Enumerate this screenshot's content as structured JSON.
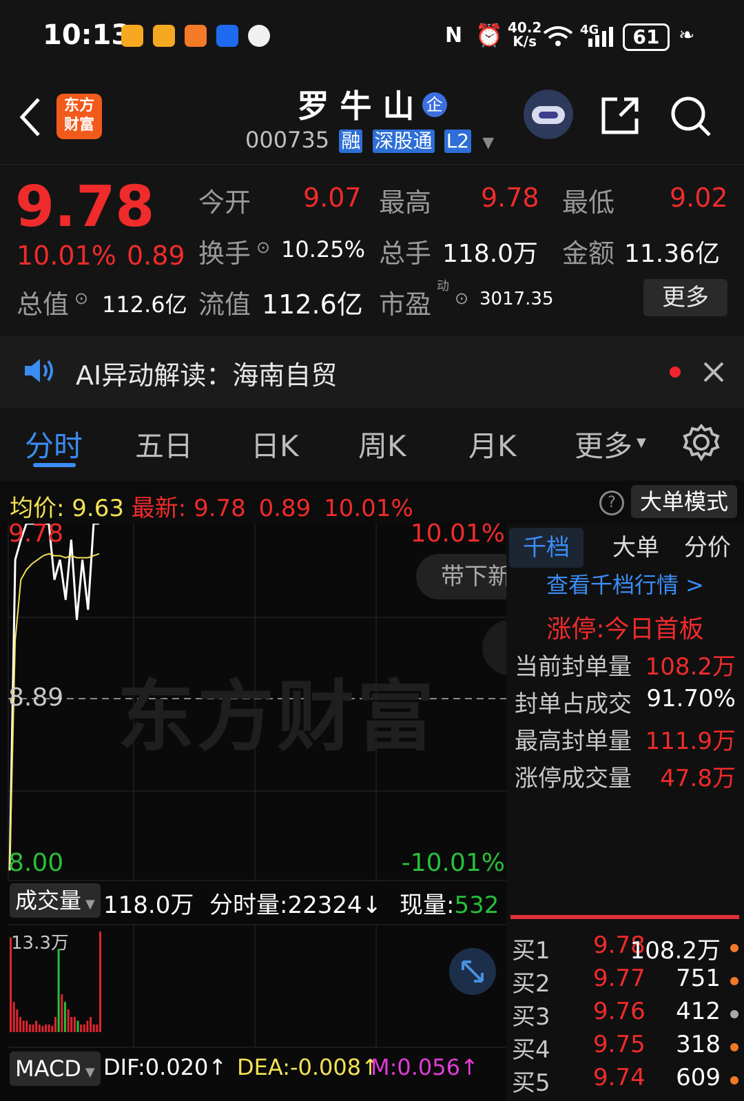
{
  "status_bar": {
    "time": "10:13",
    "net_speed_value": "40.2",
    "net_speed_unit": "K/s",
    "network": "4G",
    "battery": "61"
  },
  "header": {
    "logo_line1": "东方",
    "logo_line2": "财富",
    "stock_name": "罗 牛 山",
    "enterprise_badge": "企",
    "stock_code": "000735",
    "tags": [
      "融",
      "深股通",
      "L2"
    ]
  },
  "quote": {
    "price": "9.78",
    "change_pct": "10.01%",
    "change": "0.89",
    "open_label": "今开",
    "open": "9.07",
    "high_label": "最高",
    "high": "9.78",
    "low_label": "最低",
    "low": "9.02",
    "turnover_label": "换手",
    "turnover": "10.25%",
    "volume_label": "总手",
    "volume": "118.0万",
    "amount_label": "金额",
    "amount": "11.36亿",
    "mktcap_label": "总值",
    "mktcap": "112.6亿",
    "float_label": "流值",
    "float_cap": "112.6亿",
    "pe_label": "市盈",
    "pe_sup": "动",
    "pe": "3017.35",
    "more_label": "更多"
  },
  "ai_bar": {
    "text": "AI异动解读：海南自贸"
  },
  "tabs": [
    {
      "label": "分时"
    },
    {
      "label": "五日"
    },
    {
      "label": "日K"
    },
    {
      "label": "周K"
    },
    {
      "label": "月K"
    },
    {
      "label": "更多"
    }
  ],
  "chart_header": {
    "avg_label": "均价:",
    "avg": "9.63",
    "last_label": "最新:",
    "last": "9.78",
    "chg": "0.89",
    "chg_pct": "10.01%",
    "mode_label": "大单模式"
  },
  "chart": {
    "y_top": "9.78",
    "y_mid": "8.89",
    "y_bottom": "8.00",
    "pct_top": "10.01%",
    "pct_bottom": "-10.01%",
    "watermark": "东方财富",
    "popup": "带下新",
    "vol_label": "成交量",
    "vol_total": "118.0万",
    "minute_vol": "分时量:22324↓",
    "now_vol_label": "现量:",
    "now_vol": "532",
    "vol_axis_max": "13.3万",
    "macd_label": "MACD",
    "dif": "DIF:0.020↑",
    "dea": "DEA:-0.008↑",
    "m": "M:0.056↑"
  },
  "chart_data": {
    "type": "line",
    "ylim": [
      8.0,
      9.78
    ],
    "series": [
      {
        "values": [
          8.05,
          9.6,
          9.7,
          9.78,
          9.78,
          9.78,
          9.78,
          9.78,
          9.5,
          9.6,
          9.4,
          9.7,
          9.3,
          9.6,
          9.35,
          9.78,
          9.78
        ]
      },
      {
        "values": [
          8.05,
          9.2,
          9.5,
          9.55,
          9.58,
          9.6,
          9.62,
          9.63,
          9.62,
          9.62,
          9.61,
          9.62,
          9.61,
          9.61,
          9.61,
          9.62,
          9.63
        ]
      }
    ],
    "volume": [
      12.5,
      4.0,
      3.0,
      2.0,
      1.5,
      1.5,
      1.0,
      1.0,
      1.5,
      1.0,
      0.8,
      1.0,
      1.0,
      0.8,
      2.0,
      11.0,
      5.0,
      4.0,
      3.0,
      2.0,
      2.0,
      1.5,
      1.0,
      1.0,
      1.5,
      2.0,
      1.0,
      1.0,
      13.3
    ]
  },
  "right_panel": {
    "tabs": [
      "千档",
      "大单",
      "分价"
    ],
    "link": "查看千档行情 >",
    "limit_label": "涨停:",
    "limit_value": "今日首板",
    "rows": [
      {
        "label": "当前封单量",
        "value": "108.2万"
      },
      {
        "label": "封单占成交",
        "value": "91.70%"
      },
      {
        "label": "最高封单量",
        "value": "111.9万"
      },
      {
        "label": "涨停成交量",
        "value": "47.8万"
      }
    ],
    "bids": [
      {
        "label": "买1",
        "price": "9.78",
        "vol": "108.2万"
      },
      {
        "label": "买2",
        "price": "9.77",
        "vol": "751"
      },
      {
        "label": "买3",
        "price": "9.76",
        "vol": "412"
      },
      {
        "label": "买4",
        "price": "9.75",
        "vol": "318"
      },
      {
        "label": "买5",
        "price": "9.74",
        "vol": "609"
      }
    ]
  }
}
